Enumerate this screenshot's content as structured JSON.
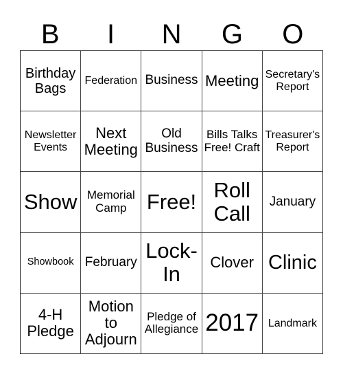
{
  "title_letters": [
    "B",
    "I",
    "N",
    "G",
    "O"
  ],
  "cells": [
    [
      "Birthday Bags",
      "Federation",
      "Business",
      "Meeting",
      "Secretary's Report"
    ],
    [
      "Newsletter Events",
      "Next Meeting",
      "Old Business",
      "Bills Talks Free! Craft",
      "Treasurer's Report"
    ],
    [
      "Show",
      "Memorial Camp",
      "Free!",
      "Roll Call",
      "January"
    ],
    [
      "Showbook",
      "February",
      "Lock-In",
      "Clover",
      "Clinic"
    ],
    [
      "4-H Pledge",
      "Motion to Adjourn",
      "Pledge of Allegiance",
      "2017",
      "Landmark"
    ]
  ]
}
